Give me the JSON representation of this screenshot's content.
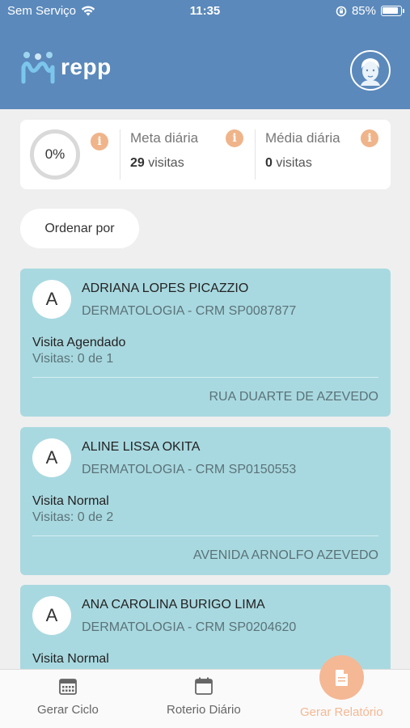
{
  "status_bar": {
    "carrier": "Sem Serviço",
    "time": "11:35",
    "battery": "85%"
  },
  "header": {
    "app_name": "repp"
  },
  "stats": {
    "progress_text": "0%",
    "progress_fraction": 0,
    "daily_goal_label": "Meta diária",
    "daily_goal_value": "29",
    "daily_goal_unit": "visitas",
    "daily_avg_label": "Média diária",
    "daily_avg_value": "0",
    "daily_avg_unit": "visitas",
    "info_glyph": "i"
  },
  "sort": {
    "label": "Ordenar por"
  },
  "visits": [
    {
      "initial": "A",
      "name": "ADRIANA LOPES PICAZZIO",
      "specialty": "DERMATOLOGIA - CRM SP0087877",
      "type": "Visita Agendado",
      "count": "Visitas: 0 de 1",
      "address": "RUA DUARTE DE AZEVEDO"
    },
    {
      "initial": "A",
      "name": "ALINE LISSA OKITA",
      "specialty": "DERMATOLOGIA - CRM SP0150553",
      "type": "Visita Normal",
      "count": "Visitas: 0 de 2",
      "address": "AVENIDA ARNOLFO AZEVEDO"
    },
    {
      "initial": "A",
      "name": "ANA CAROLINA BURIGO LIMA",
      "specialty": "DERMATOLOGIA - CRM SP0204620",
      "type": "Visita Normal",
      "count": "",
      "address": ""
    }
  ],
  "bottom_nav": {
    "items": [
      {
        "label": "Gerar Ciclo",
        "icon": "calendar-grid-icon"
      },
      {
        "label": "Roterio Diário",
        "icon": "calendar-icon"
      },
      {
        "label": "Gerar Relatório",
        "icon": "document-icon"
      }
    ]
  },
  "colors": {
    "header": "#5b89bb",
    "card": "#a9d9e0",
    "accent": "#f4b894",
    "info": "#f0b48a"
  }
}
